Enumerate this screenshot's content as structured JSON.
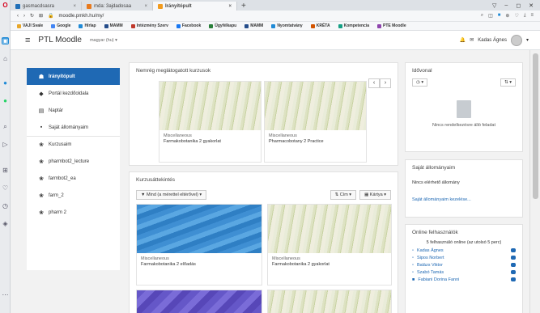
{
  "browser": {
    "tabs": [
      {
        "label": "gasmacdsasra"
      },
      {
        "label": "mda: 3ajdadosaa"
      },
      {
        "label": "Irányítópult",
        "active": true
      }
    ],
    "new_tab": "+",
    "window_controls": [
      "▽",
      "–",
      "◻",
      "✕"
    ],
    "url": "moodle.pmkh.hu/my/",
    "bookmarks": [
      "VAJI Svale",
      "Google",
      "Hírlap",
      "MAMM",
      "Intézmény Szerv",
      "Facebook",
      "Ügyfélkapu",
      "MAMM",
      "Nyomtatvány",
      "KRÉTA",
      "Kompetencia",
      "PTE Moodle"
    ]
  },
  "navbar": {
    "brand": "PTL Moodle",
    "language": "magyar (hu) ▾",
    "user": "Kadas Ágnes"
  },
  "drawer": {
    "items": [
      {
        "icon": "☗",
        "label": "Irányítópult",
        "active": true
      },
      {
        "icon": "◆",
        "label": "Portál kezdőoldala"
      },
      {
        "icon": "▤",
        "label": "Naptár"
      },
      {
        "icon": "▪",
        "label": "Saját állományaim"
      },
      {
        "icon": "❀",
        "label": "Kurzusaim",
        "sep": true
      },
      {
        "icon": "❀",
        "label": "pharmbot2_lecture"
      },
      {
        "icon": "❀",
        "label": "farmbot2_ea"
      },
      {
        "icon": "❀",
        "label": "farm_2"
      },
      {
        "icon": "❀",
        "label": "pharm 2"
      }
    ]
  },
  "recent": {
    "title": "Nemrég meglátogatott kurzusok",
    "prev": "‹",
    "next": "›",
    "courses": [
      {
        "category": "Miscellaneous",
        "name": "Farmakobotanika 2 gyakorlat"
      },
      {
        "category": "Miscellaneous",
        "name": "Pharmacobotany 2 Practice"
      }
    ]
  },
  "overview": {
    "title": "Kurzusáttekintés",
    "filter": "▼ Mind (a mérettel eltérővel) ▾",
    "sort": "⇅ Cím ▾",
    "view": "▦ Kártya ▾",
    "courses": [
      {
        "category": "Miscellaneous",
        "name": "Farmakobotanika 2 előadás"
      },
      {
        "category": "Miscellaneous",
        "name": "Farmakobotanika 2 gyakorlat"
      }
    ]
  },
  "timeline": {
    "title": "Idővonal",
    "filter": "◷ ▾",
    "sort": "⇅ ▾",
    "empty": "Nincs rendelkezésre álló feladat"
  },
  "files": {
    "title": "Saját állományaim",
    "empty": "Nincs elérhető állomány",
    "manage": "Saját állományaim kezelése..."
  },
  "online": {
    "title": "Online felhasználók",
    "subtitle": "5 felhasználó online (az utolsó 5 perc)",
    "users": [
      "Kadas Ágnes",
      "Sipos Norbert",
      "Balázs Viktor",
      "Szabó Tamás",
      "Fabiani Dorina Fanni"
    ]
  }
}
